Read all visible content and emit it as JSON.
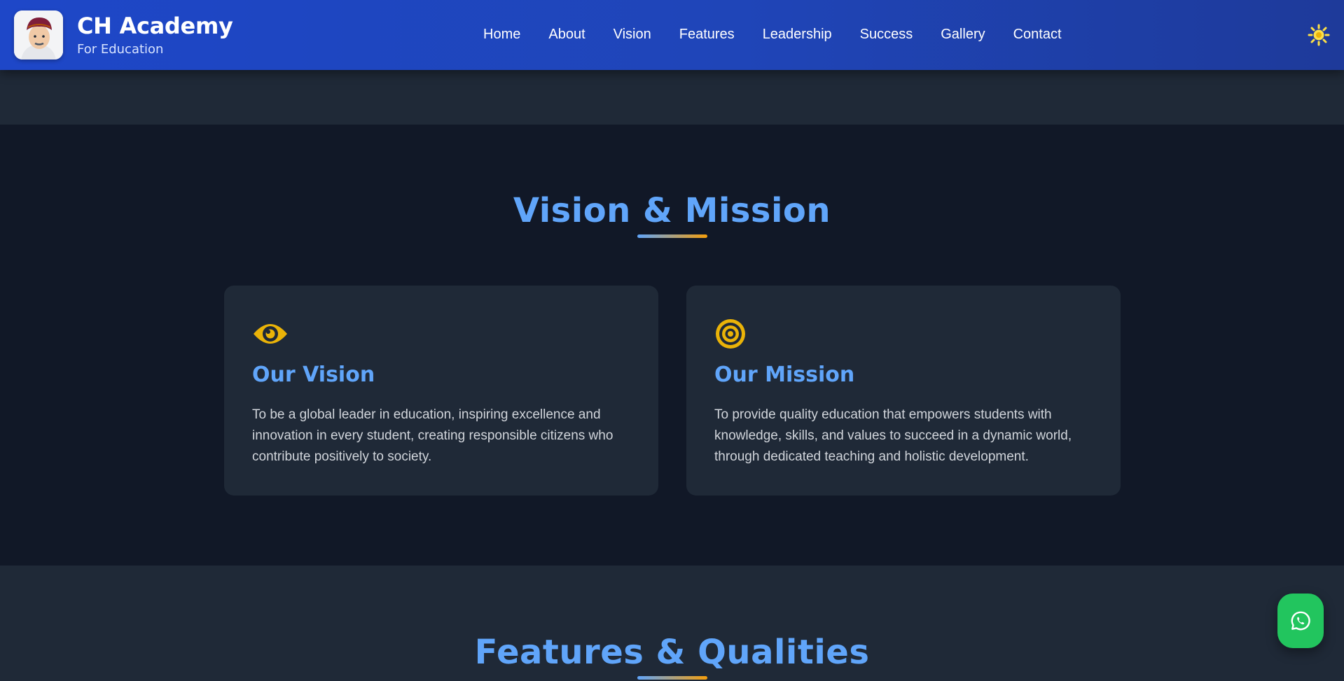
{
  "brand": {
    "title": "CH Academy",
    "subtitle": "For Education",
    "logo_icon": "founder-portrait-icon"
  },
  "nav": {
    "items": [
      {
        "label": "Home"
      },
      {
        "label": "About"
      },
      {
        "label": "Vision"
      },
      {
        "label": "Features"
      },
      {
        "label": "Leadership"
      },
      {
        "label": "Success"
      },
      {
        "label": "Gallery"
      },
      {
        "label": "Contact"
      }
    ],
    "theme_toggle_icon": "sun-icon"
  },
  "vision_section": {
    "title": "Vision & Mission",
    "cards": [
      {
        "icon": "eye-icon",
        "title": "Our Vision",
        "text": "To be a global leader in education, inspiring excellence and innovation in every student, creating responsible citizens who contribute positively to society."
      },
      {
        "icon": "target-icon",
        "title": "Our Mission",
        "text": "To provide quality education that empowers students with knowledge, skills, and values to succeed in a dynamic world, through dedicated teaching and holistic development."
      }
    ]
  },
  "features_section": {
    "title": "Features & Qualities"
  },
  "floating": {
    "whatsapp_icon": "whatsapp-icon"
  },
  "colors": {
    "header_start": "#1e47c8",
    "header_end": "#1e3a9a",
    "page_bg": "#111827",
    "card_bg": "#1f2937",
    "accent_blue": "#60a5fa",
    "accent_gold": "#eab308",
    "whatsapp_green": "#22c55e"
  }
}
